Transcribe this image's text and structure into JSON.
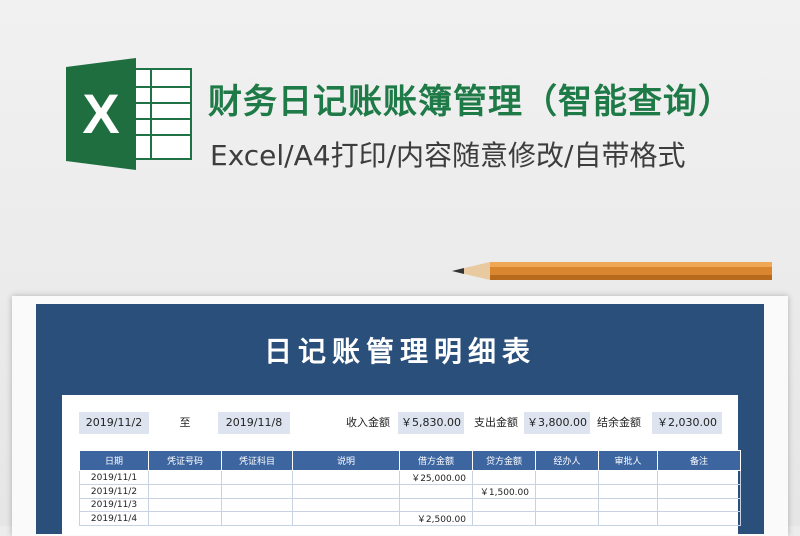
{
  "header": {
    "title": "财务日记账账簿管理（智能查询）",
    "subtitle": "Excel/A4打印/内容随意修改/自带格式",
    "logo_letter": "X",
    "logo_icon": "excel-icon",
    "brand_color": "#1e7a46"
  },
  "sheet": {
    "title": "日记账管理明细表",
    "panel_color": "#2a4f7a",
    "filter": {
      "start_date": "2019/11/2",
      "to_label": "至",
      "end_date": "2019/11/8",
      "income_label": "收入金额",
      "income_value": "￥5,830.00",
      "expense_label": "支出金额",
      "expense_value": "￥3,800.00",
      "balance_label": "结余金额",
      "balance_value": "￥2,030.00"
    },
    "columns": [
      "日期",
      "凭证号码",
      "凭证科目",
      "说明",
      "借方金额",
      "贷方金额",
      "经办人",
      "审批人",
      "备注"
    ],
    "rows": [
      {
        "date": "2019/11/1",
        "debit": "￥25,000.00",
        "credit": ""
      },
      {
        "date": "2019/11/2",
        "debit": "",
        "credit": "￥1,500.00"
      },
      {
        "date": "2019/11/3",
        "debit": "",
        "credit": ""
      },
      {
        "date": "2019/11/4",
        "debit": "￥2,500.00",
        "credit": ""
      }
    ]
  },
  "decor": {
    "pencil_icon": "pencil-icon"
  }
}
